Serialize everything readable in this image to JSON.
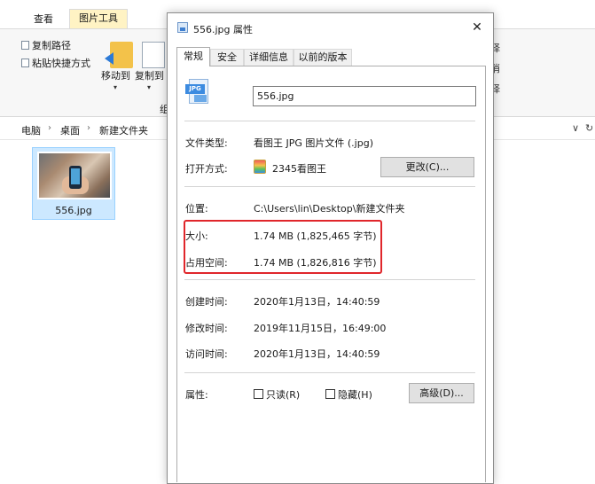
{
  "explorer": {
    "ribbon_tabs": {
      "view": "查看",
      "picture_tools": "图片工具"
    },
    "clipboard": {
      "copy_path": "复制路径",
      "paste_shortcut": "粘贴快捷方式"
    },
    "organize": {
      "move_to": "移动到",
      "copy_to": "复制到",
      "group_fragment": "组"
    },
    "right_partial": [
      "择",
      "消",
      "择"
    ],
    "breadcrumb": [
      "电脑",
      "桌面",
      "新建文件夹"
    ],
    "address_right": [
      "∨",
      "↻"
    ],
    "file": {
      "name": "556.jpg"
    }
  },
  "dialog": {
    "title": "556.jpg 属性",
    "close": "✕",
    "tabs": [
      "常规",
      "安全",
      "详细信息",
      "以前的版本"
    ],
    "filename_value": "556.jpg",
    "file_icon_label": "JPG",
    "type_label": "文件类型:",
    "type_value": "看图王 JPG 图片文件 (.jpg)",
    "open_with_label": "打开方式:",
    "open_with_value": "2345看图王",
    "change_button": "更改(C)...",
    "location_label": "位置:",
    "location_value": "C:\\Users\\lin\\Desktop\\新建文件夹",
    "size_label": "大小:",
    "size_value": "1.74 MB (1,825,465 字节)",
    "size_on_disk_label": "占用空间:",
    "size_on_disk_value": "1.74 MB (1,826,816 字节)",
    "created_label": "创建时间:",
    "created_value": "2020年1月13日，14:40:59",
    "modified_label": "修改时间:",
    "modified_value": "2019年11月15日，16:49:00",
    "accessed_label": "访问时间:",
    "accessed_value": "2020年1月13日，14:40:59",
    "attributes_label": "属性:",
    "readonly_label": "只读(R)",
    "readonly_checked": false,
    "hidden_label": "隐藏(H)",
    "hidden_checked": false,
    "advanced_button": "高级(D)..."
  },
  "colors": {
    "highlight_border": "#e0262b",
    "selection_fill": "#cce8ff",
    "picture_tools_tab": "#fff3c4"
  }
}
